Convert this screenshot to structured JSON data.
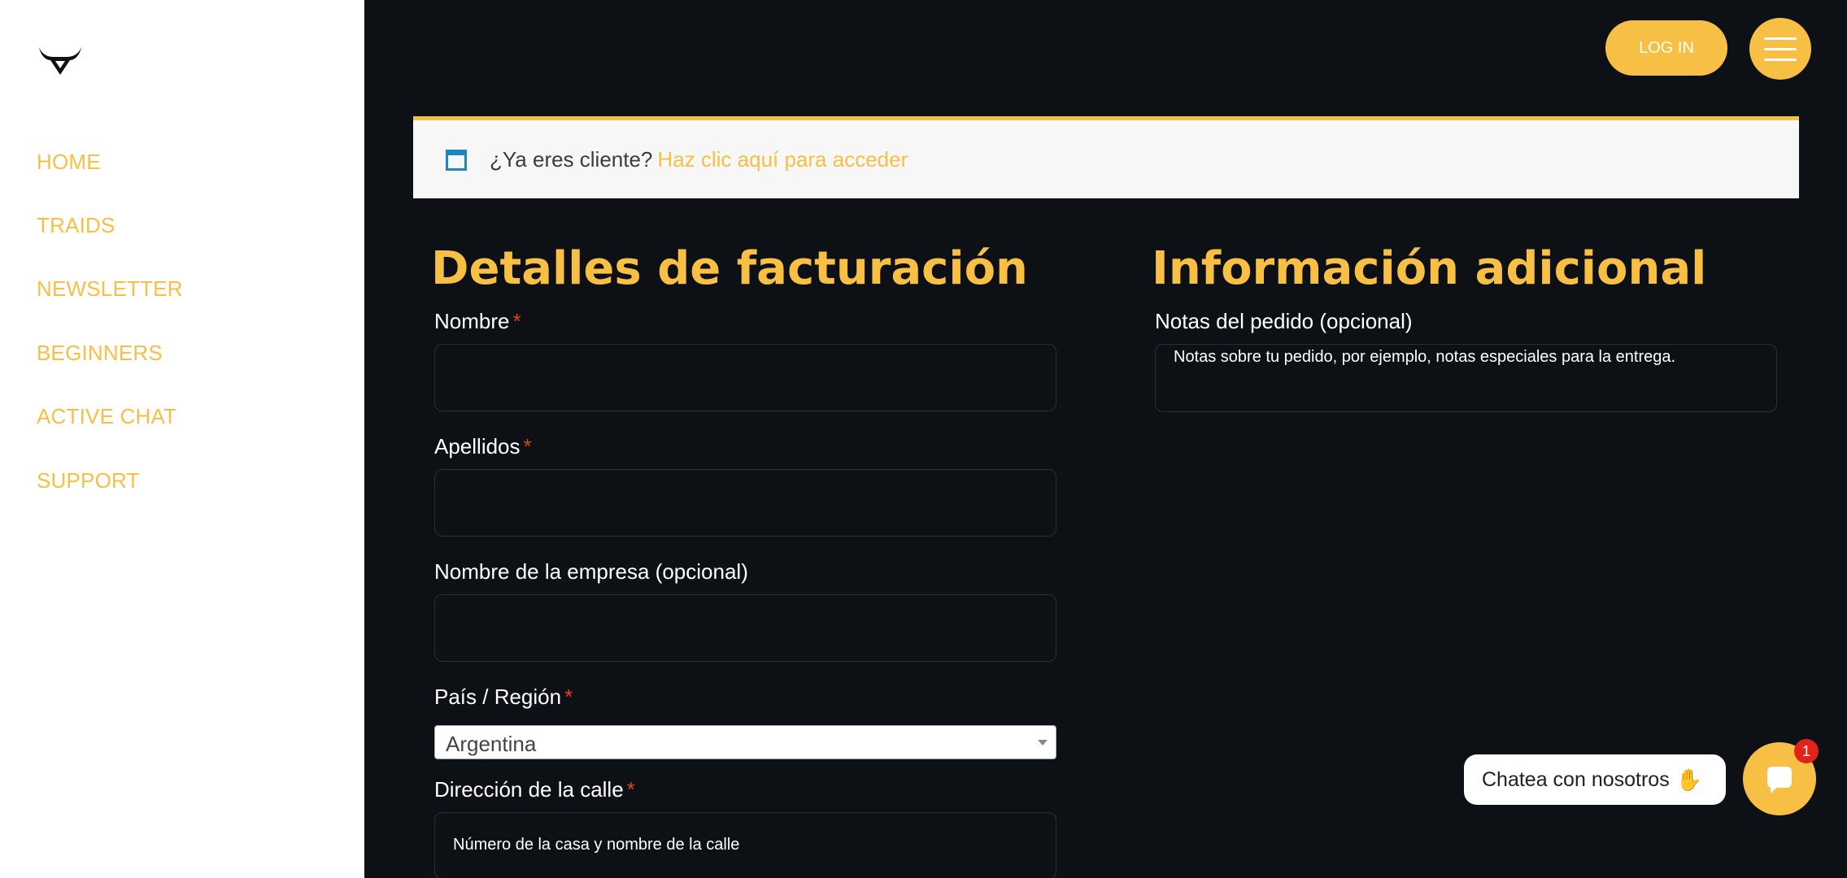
{
  "sidebar": {
    "logo": "bull-logo-icon",
    "items": [
      {
        "label": "HOME"
      },
      {
        "label": "TRAIDS"
      },
      {
        "label": "NEWSLETTER"
      },
      {
        "label": "BEGINNERS"
      },
      {
        "label": "ACTIVE CHAT"
      },
      {
        "label": "SUPPORT"
      }
    ]
  },
  "header": {
    "login_label": "LOG IN",
    "menu_icon": "hamburger-menu-icon"
  },
  "notice": {
    "text": "¿Ya eres cliente?",
    "link": "Haz clic aquí para acceder",
    "icon": "window-icon"
  },
  "billing": {
    "title": "Detalles de facturación",
    "first_name_label": "Nombre",
    "last_name_label": "Apellidos",
    "company_label": "Nombre de la empresa (opcional)",
    "country_label": "País / Región",
    "country_value": "Argentina",
    "street_label": "Dirección de la calle",
    "street_placeholder": "Número de la casa y nombre de la calle",
    "required_mark": "*"
  },
  "additional": {
    "title": "Información adicional",
    "notes_label": "Notas del pedido (opcional)",
    "notes_placeholder": "Notas sobre tu pedido, por ejemplo, notas especiales para la entrega."
  },
  "chat": {
    "bubble_text": "Chatea con nosotros",
    "wave_icon": "waving-hand-icon",
    "badge_count": "1",
    "icon": "chat-icon"
  },
  "colors": {
    "accent": "#f8bf45",
    "background": "#0d1015",
    "required": "#e2401c"
  }
}
